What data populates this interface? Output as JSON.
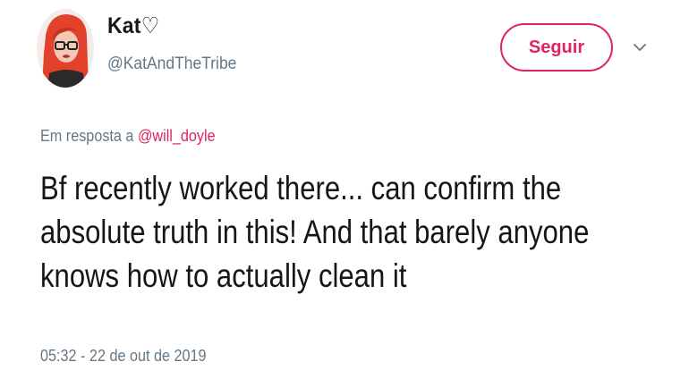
{
  "user": {
    "display_name": "Kat♡",
    "username": "@KatAndTheTribe"
  },
  "actions": {
    "follow_label": "Seguir",
    "more_icon": "chevron-down-icon"
  },
  "tweet": {
    "reply_prefix": "Em resposta a ",
    "reply_to": "@will_doyle",
    "text": "Bf recently worked there... can confirm the absolute truth in this! And that barely anyone knows how to actually clean it",
    "timestamp": "05:32 - 22 de out de 2019"
  },
  "colors": {
    "accent": "#e0245e",
    "secondary_text": "#657786",
    "primary_text": "#14171a"
  }
}
